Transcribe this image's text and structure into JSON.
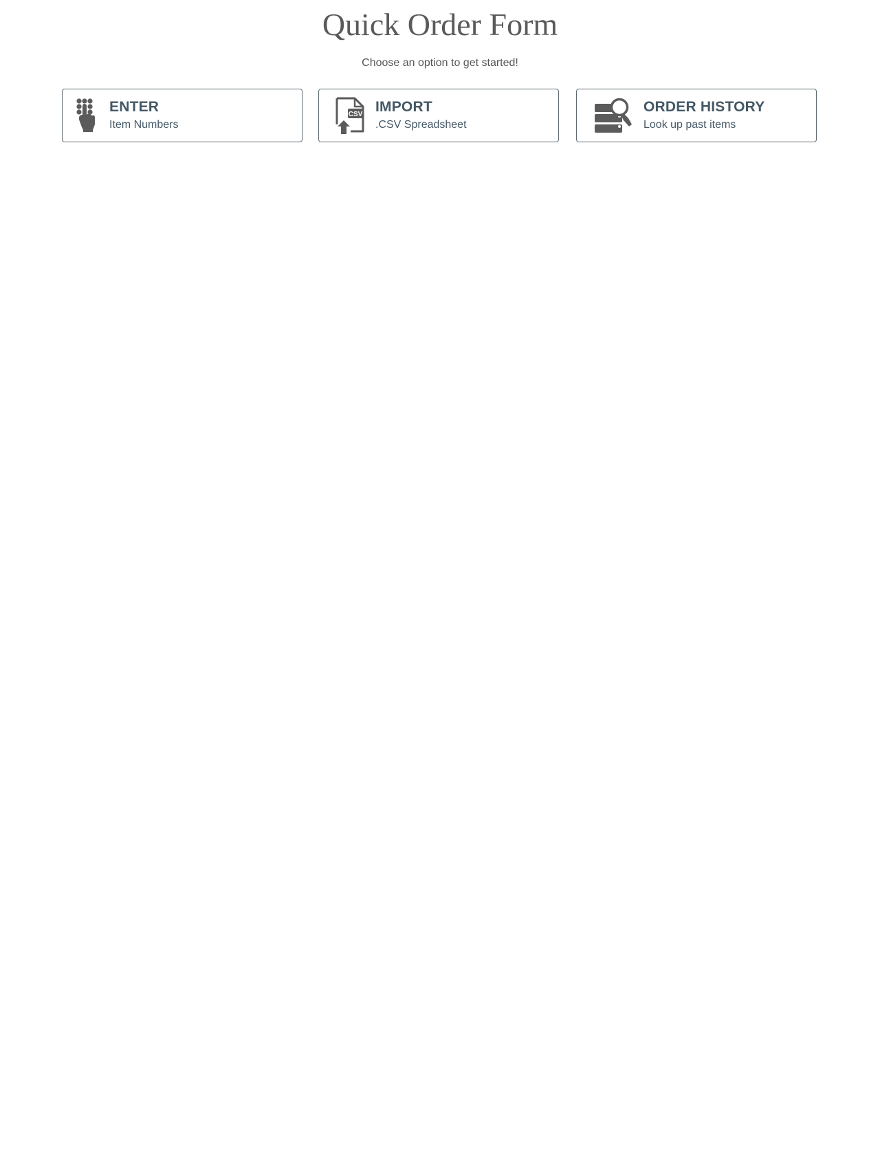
{
  "page": {
    "title": "Quick Order Form",
    "subtitle": "Choose an option to get started!"
  },
  "options": [
    {
      "title": "ENTER",
      "description": "Item Numbers",
      "icon": "keypad-hand-icon"
    },
    {
      "title": "IMPORT",
      "description": ".CSV Spreadsheet",
      "icon": "csv-upload-icon"
    },
    {
      "title": "ORDER HISTORY",
      "description": "Look up past items",
      "icon": "history-search-icon"
    }
  ],
  "colors": {
    "title_text": "#5a5a5a",
    "option_text": "#445866",
    "border": "#5f6b72",
    "icon": "#5b5b5b"
  }
}
